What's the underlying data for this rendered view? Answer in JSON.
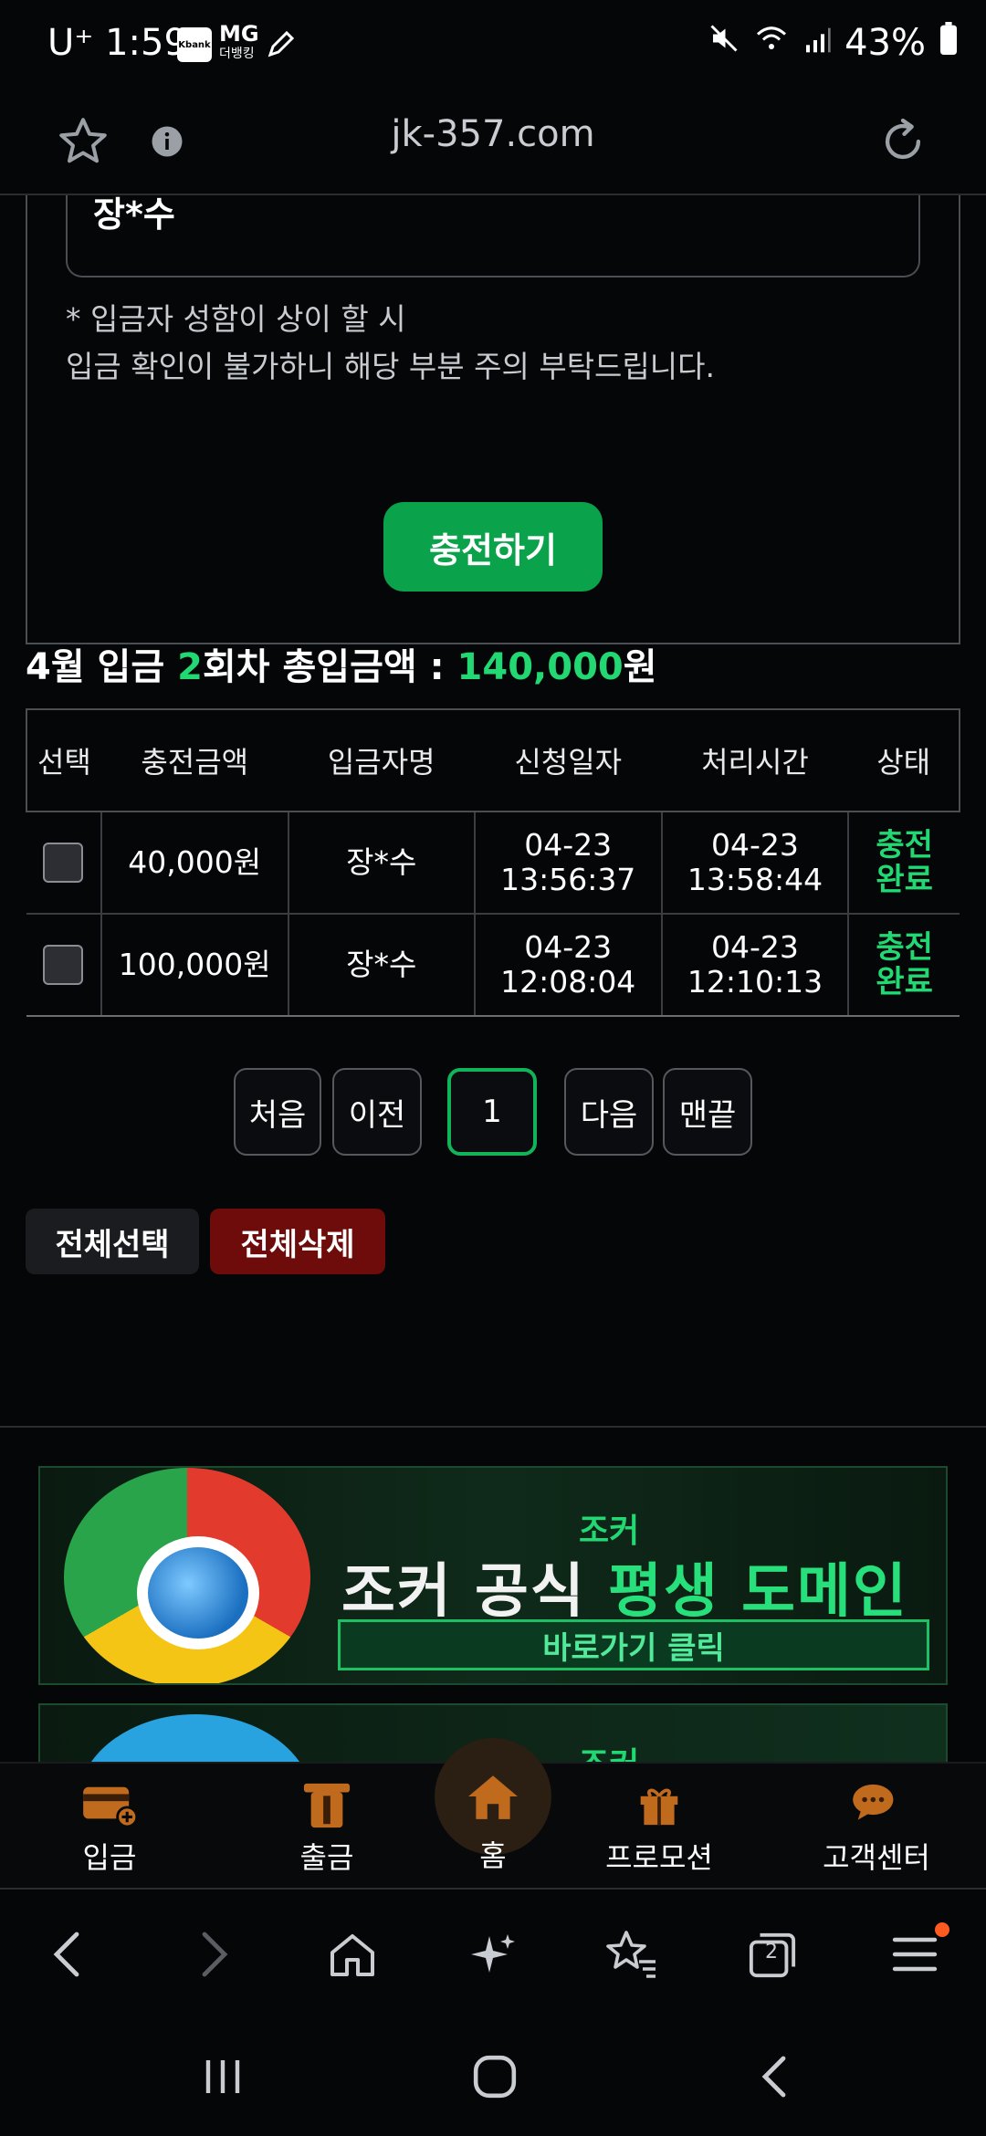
{
  "status_bar": {
    "time": "1:59",
    "carrier": "U⁺",
    "app_chip": "Kbank",
    "mg_label": "MG",
    "mg_sub": "더뱅킹",
    "battery": "43%"
  },
  "browser": {
    "url": "jk-357.com"
  },
  "form": {
    "depositor_name": "장*수",
    "notice_line1": "* 입금자 성함이 상이 할 시",
    "notice_line2": "입금 확인이 불가하니 해당 부분 주의 부탁드립니다.",
    "charge_button": "충전하기"
  },
  "summary": {
    "month_label": "4월 입금",
    "count": "2",
    "count_suffix": "회차 총입금액 :",
    "amount": "140,000",
    "currency": "원"
  },
  "table": {
    "headers": [
      "선택",
      "충전금액",
      "입금자명",
      "신청일자",
      "처리시간",
      "상태"
    ],
    "rows": [
      {
        "amount": "40,000원",
        "name": "장*수",
        "req_date": "04-23",
        "req_time": "13:56:37",
        "proc_date": "04-23",
        "proc_time": "13:58:44",
        "status1": "충전",
        "status2": "완료"
      },
      {
        "amount": "100,000원",
        "name": "장*수",
        "req_date": "04-23",
        "req_time": "12:08:04",
        "proc_date": "04-23",
        "proc_time": "12:10:13",
        "status1": "충전",
        "status2": "완료"
      }
    ]
  },
  "pagination": {
    "first": "처음",
    "prev": "이전",
    "current": "1",
    "next": "다음",
    "last": "맨끝"
  },
  "actions": {
    "select_all": "전체선택",
    "delete_all": "전체삭제"
  },
  "banner": {
    "brand": "조커",
    "headline_white": "조커 공식",
    "headline_green": "평생 도메인",
    "cta": "바로가기 클릭"
  },
  "banner2": {
    "brand": "조커"
  },
  "app_nav": {
    "items": [
      "입금",
      "출금",
      "홈",
      "프로모션",
      "고객센터"
    ],
    "accent_color": "#c06a1e"
  },
  "browser_toolbar": {
    "tabs_count": "2"
  },
  "colors": {
    "brand_green": "#22d873",
    "button_green": "#0aa24a",
    "delete_red": "#6e0b0b",
    "background": "#050608"
  }
}
